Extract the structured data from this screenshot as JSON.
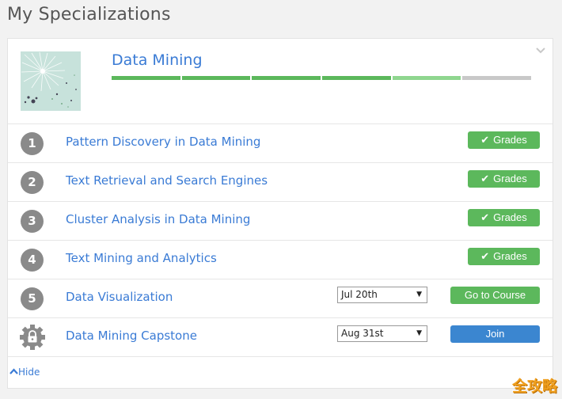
{
  "page": {
    "title": "My Specializations"
  },
  "specialization": {
    "title": "Data Mining",
    "progress_segments": [
      {
        "color": "#5cb85c"
      },
      {
        "color": "#5cb85c"
      },
      {
        "color": "#5cb85c"
      },
      {
        "color": "#5cb85c"
      },
      {
        "color": "#8fd68f"
      },
      {
        "color": "#c8c8c8"
      }
    ],
    "courses": [
      {
        "number": "1",
        "title": "Pattern Discovery in Data Mining",
        "action": "Grades"
      },
      {
        "number": "2",
        "title": "Text Retrieval and Search Engines",
        "action": "Grades"
      },
      {
        "number": "3",
        "title": "Cluster Analysis in Data Mining",
        "action": "Grades"
      },
      {
        "number": "4",
        "title": "Text Mining and Analytics",
        "action": "Grades"
      },
      {
        "number": "5",
        "title": "Data Visualization",
        "date": "Jul 20th",
        "action": "Go to Course"
      },
      {
        "icon": "lock-icon",
        "title": "Data Mining Capstone",
        "date": "Aug 31st",
        "action": "Join"
      }
    ],
    "hide_label": "Hide"
  },
  "colors": {
    "accent": "#3a7bd5",
    "success": "#5cb85c",
    "join": "#3b86d0"
  },
  "watermark": "全攻略"
}
